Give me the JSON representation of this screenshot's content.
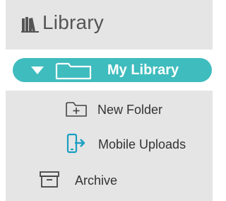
{
  "header": {
    "title": "Library",
    "icon": "books-icon"
  },
  "tree": {
    "root": {
      "label": "My Library",
      "expanded": true,
      "selected": true,
      "icons": [
        "triangle-down-icon",
        "folder-icon"
      ],
      "accent_color": "#3fbcbe"
    },
    "children": [
      {
        "label": "New Folder",
        "icon": "new-folder-icon"
      },
      {
        "label": "Mobile Uploads",
        "icon": "mobile-upload-icon"
      }
    ],
    "archive": {
      "label": "Archive",
      "icon": "archive-box-icon"
    }
  },
  "colors": {
    "panel_bg": "#e5e5e5",
    "selected_row_bg": "#ffffff",
    "accent": "#3fbcbe",
    "text": "#333333",
    "header_text": "#555555"
  }
}
